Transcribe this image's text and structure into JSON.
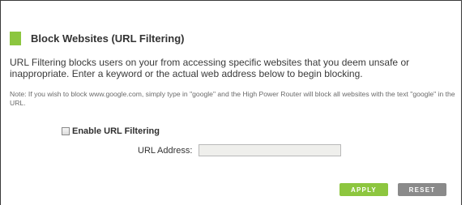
{
  "section": {
    "title": "Block Websites (URL Filtering)",
    "description": "URL Filtering blocks users on your from accessing specific websites that you deem unsafe or inappropriate. Enter a keyword or the actual web address below to begin blocking.",
    "note": "Note: If you wish to block www.google.com, simply type in \"google\" and the High Power Router will block all websites with the text \"google\" in the URL."
  },
  "form": {
    "enable_label": "Enable URL Filtering",
    "enable_checked": false,
    "url_label": "URL Address:",
    "url_value": ""
  },
  "buttons": {
    "apply": "APPLY",
    "reset": "RESET"
  },
  "colors": {
    "accent": "#8dc63f",
    "reset_button": "#8a8a8a"
  }
}
